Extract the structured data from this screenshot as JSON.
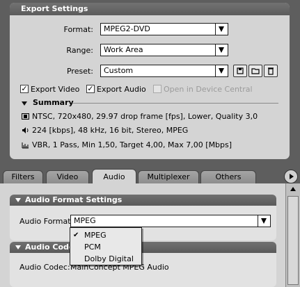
{
  "export_settings": {
    "title": "Export Settings",
    "format": {
      "label": "Format:",
      "value": "MPEG2-DVD"
    },
    "range": {
      "label": "Range:",
      "value": "Work Area"
    },
    "preset": {
      "label": "Preset:",
      "value": "Custom"
    },
    "export_video": {
      "label": "Export Video",
      "checked": true,
      "check_mark": "✓"
    },
    "export_audio": {
      "label": "Export Audio",
      "checked": true,
      "check_mark": "✓"
    },
    "open_device_central": {
      "label": "Open in Device Central",
      "checked": false,
      "enabled": false
    }
  },
  "summary": {
    "title": "Summary",
    "video_line": "NTSC, 720x480, 29.97 drop frame [fps], Lower, Quality 3,0",
    "audio_line": "224 [kbps], 48 kHz, 16 bit, Stereo, MPEG",
    "bitrate_line": "VBR, 1 Pass, Min 1,50, Target 4,00, Max 7,00 [Mbps]"
  },
  "tabs": [
    {
      "label": "Filters",
      "active": false
    },
    {
      "label": "Video",
      "active": false
    },
    {
      "label": "Audio",
      "active": true
    },
    {
      "label": "Multiplexer",
      "active": false
    },
    {
      "label": "Others",
      "active": false
    }
  ],
  "audio_format_settings": {
    "title": "Audio Format Settings",
    "audio_format": {
      "label": "Audio Format:",
      "value": "MPEG"
    }
  },
  "audio_format_menu": {
    "check_mark": "✔",
    "options": [
      "MPEG",
      "PCM",
      "Dolby Digital"
    ],
    "selected": "MPEG"
  },
  "audio_codec": {
    "title": "Audio Codec",
    "label": "Audio Codec:",
    "value": "MainConcept MPEG Audio"
  },
  "colors": {
    "background": "#5e5e5e",
    "panel": "#d4d4d4",
    "header": "#666666"
  }
}
